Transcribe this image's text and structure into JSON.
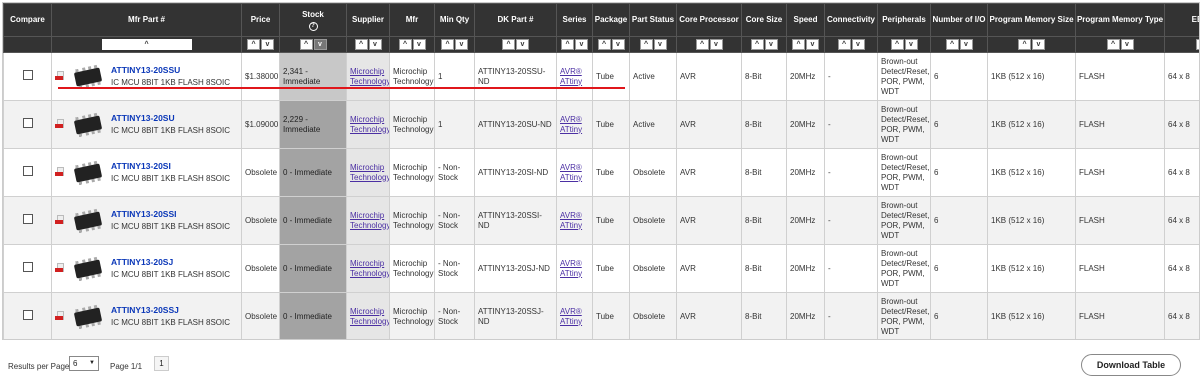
{
  "columns": [
    "Compare",
    "Mfr Part #",
    "Price",
    "Stock",
    "Supplier",
    "Mfr",
    "Min Qty",
    "DK Part #",
    "Series",
    "Package",
    "Part Status",
    "Core Processor",
    "Core Size",
    "Speed",
    "Connectivity",
    "Peripherals",
    "Number of I/O",
    "Program Memory Size",
    "Program Memory Type",
    "EEPROM"
  ],
  "stock_help": "?",
  "sort_up": "^",
  "sort_down": "v",
  "rows": [
    {
      "part": "ATTINY13-20SSU",
      "desc": "IC MCU 8BIT 1KB FLASH 8SOIC",
      "price": "$1.38000",
      "stock": "2,341 - Immediate",
      "supplier": "Microchip Technology",
      "mfr": "Microchip Technology",
      "minqty": "1",
      "dk": "ATTINY13-20SSU-ND",
      "series": "AVR® ATtiny",
      "package": "Tube",
      "status": "Active",
      "core": "AVR",
      "size": "8-Bit",
      "speed": "20MHz",
      "conn": "-",
      "periph": "Brown-out Detect/Reset, POR, PWM, WDT",
      "io": "6",
      "pms": "1KB (512 x 16)",
      "pmt": "FLASH",
      "eeprom": "64 x 8"
    },
    {
      "part": "ATTINY13-20SU",
      "desc": "IC MCU 8BIT 1KB FLASH 8SOIC",
      "price": "$1.09000",
      "stock": "2,229 - Immediate",
      "supplier": "Microchip Technology",
      "mfr": "Microchip Technology",
      "minqty": "1",
      "dk": "ATTINY13-20SU-ND",
      "series": "AVR® ATtiny",
      "package": "Tube",
      "status": "Active",
      "core": "AVR",
      "size": "8-Bit",
      "speed": "20MHz",
      "conn": "-",
      "periph": "Brown-out Detect/Reset, POR, PWM, WDT",
      "io": "6",
      "pms": "1KB (512 x 16)",
      "pmt": "FLASH",
      "eeprom": "64 x 8"
    },
    {
      "part": "ATTINY13-20SI",
      "desc": "IC MCU 8BIT 1KB FLASH 8SOIC",
      "price": "Obsolete",
      "stock": "0 - Immediate",
      "supplier": "Microchip Technology",
      "mfr": "Microchip Technology",
      "minqty": "- Non-Stock",
      "dk": "ATTINY13-20SI-ND",
      "series": "AVR® ATtiny",
      "package": "Tube",
      "status": "Obsolete",
      "core": "AVR",
      "size": "8-Bit",
      "speed": "20MHz",
      "conn": "-",
      "periph": "Brown-out Detect/Reset, POR, PWM, WDT",
      "io": "6",
      "pms": "1KB (512 x 16)",
      "pmt": "FLASH",
      "eeprom": "64 x 8"
    },
    {
      "part": "ATTINY13-20SSI",
      "desc": "IC MCU 8BIT 1KB FLASH 8SOIC",
      "price": "Obsolete",
      "stock": "0 - Immediate",
      "supplier": "Microchip Technology",
      "mfr": "Microchip Technology",
      "minqty": "- Non-Stock",
      "dk": "ATTINY13-20SSI-ND",
      "series": "AVR® ATtiny",
      "package": "Tube",
      "status": "Obsolete",
      "core": "AVR",
      "size": "8-Bit",
      "speed": "20MHz",
      "conn": "-",
      "periph": "Brown-out Detect/Reset, POR, PWM, WDT",
      "io": "6",
      "pms": "1KB (512 x 16)",
      "pmt": "FLASH",
      "eeprom": "64 x 8"
    },
    {
      "part": "ATTINY13-20SJ",
      "desc": "IC MCU 8BIT 1KB FLASH 8SOIC",
      "price": "Obsolete",
      "stock": "0 - Immediate",
      "supplier": "Microchip Technology",
      "mfr": "Microchip Technology",
      "minqty": "- Non-Stock",
      "dk": "ATTINY13-20SJ-ND",
      "series": "AVR® ATtiny",
      "package": "Tube",
      "status": "Obsolete",
      "core": "AVR",
      "size": "8-Bit",
      "speed": "20MHz",
      "conn": "-",
      "periph": "Brown-out Detect/Reset, POR, PWM, WDT",
      "io": "6",
      "pms": "1KB (512 x 16)",
      "pmt": "FLASH",
      "eeprom": "64 x 8"
    },
    {
      "part": "ATTINY13-20SSJ",
      "desc": "IC MCU 8BIT 1KB FLASH 8SOIC",
      "price": "Obsolete",
      "stock": "0 - Immediate",
      "supplier": "Microchip Technology",
      "mfr": "Microchip Technology",
      "minqty": "- Non-Stock",
      "dk": "ATTINY13-20SSJ-ND",
      "series": "AVR® ATtiny",
      "package": "Tube",
      "status": "Obsolete",
      "core": "AVR",
      "size": "8-Bit",
      "speed": "20MHz",
      "conn": "-",
      "periph": "Brown-out Detect/Reset, POR, PWM, WDT",
      "io": "6",
      "pms": "1KB (512 x 16)",
      "pmt": "FLASH",
      "eeprom": "64 x 8"
    }
  ],
  "footer": {
    "results_label": "Results per Page",
    "results_value": "6",
    "page_label": "Page 1/1",
    "page_button": "1",
    "download": "Download Table"
  },
  "icons": [
    "checkbox-icon",
    "datasheet-pdf-icon",
    "chip-thumbnail-icon",
    "sort-up-icon",
    "sort-down-icon",
    "help-icon",
    "chevron-down-icon"
  ],
  "colors": {
    "header_bg": "#333333",
    "link_blue": "#0a37b8",
    "link_purple": "#4b2fa3",
    "stock_bg": "#a3a3a3",
    "annotation_red": "#e0161b"
  }
}
